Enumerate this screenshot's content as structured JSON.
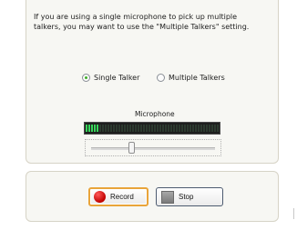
{
  "description": "If you are using a single microphone to pick up multiple talkers, you may want to use the \"Multiple Talkers\" setting.",
  "talker_mode": {
    "options": [
      "Single Talker",
      "Multiple Talkers"
    ],
    "selected": "Single Talker"
  },
  "microphone": {
    "label": "Microphone",
    "input_level_fraction": 0.11,
    "meter_color": "#37d65a",
    "gain_slider_fraction": 0.32
  },
  "buttons": {
    "record_label": "Record",
    "stop_label": "Stop"
  },
  "icons": {
    "record": "record-circle-icon",
    "stop": "stop-square-icon"
  },
  "colors": {
    "panel_bg": "#f7f7f3",
    "panel_border": "#d6d3c6",
    "focus_border": "#e9a43a",
    "record_red": "#c00000"
  }
}
